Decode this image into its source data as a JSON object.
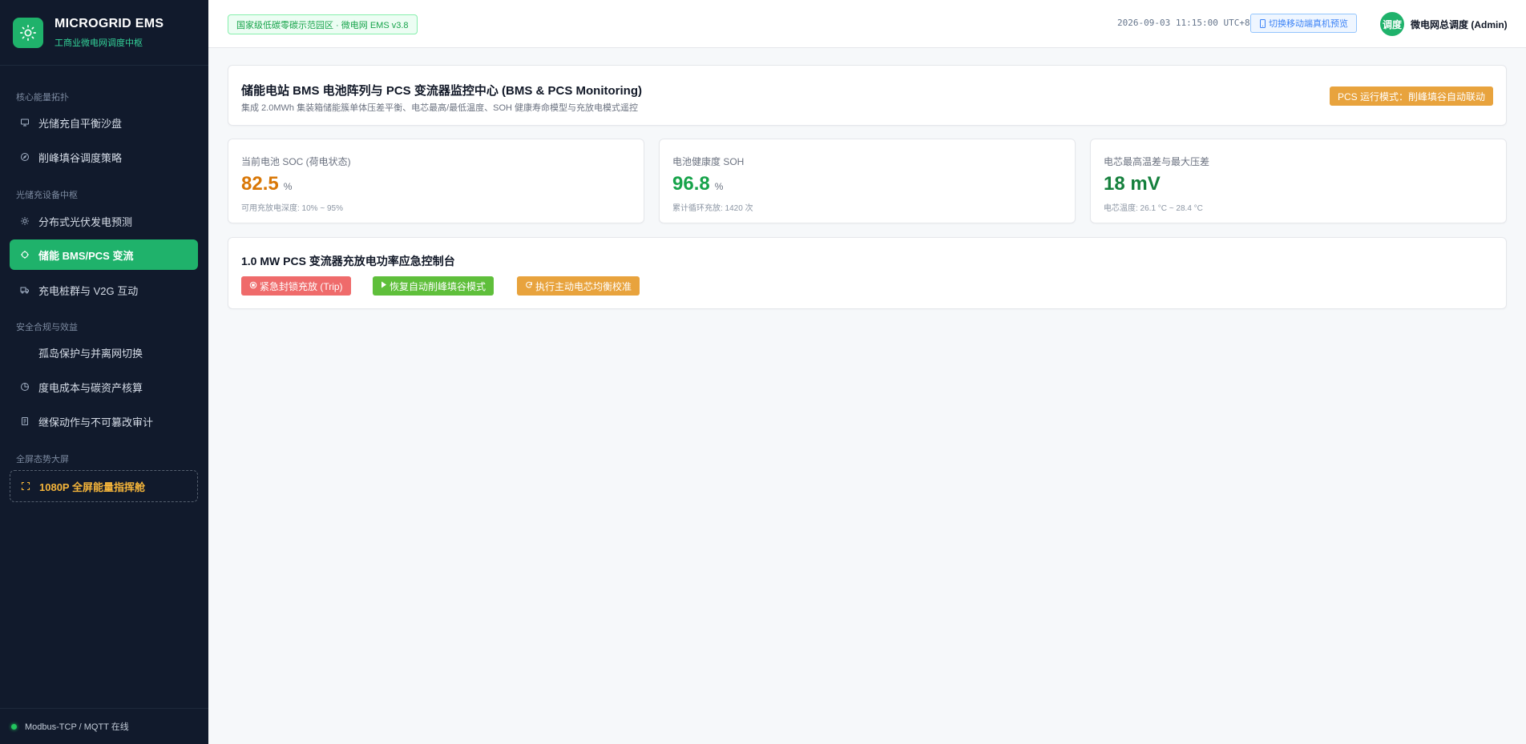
{
  "brand": {
    "title": "MICROGRID EMS",
    "subtitle": "工商业微电网调度中枢",
    "logo_icon": "sun-icon",
    "accent": "#1fb26b"
  },
  "sidebar": {
    "groups": [
      {
        "label": "核心能量拓扑"
      },
      {
        "label": "光储充设备中枢"
      },
      {
        "label": "安全合规与效益"
      },
      {
        "label": "全屏态势大屏"
      }
    ],
    "items": [
      {
        "label": "光储充自平衡沙盘",
        "icon": "monitor-icon",
        "active": false
      },
      {
        "label": "削峰填谷调度策略",
        "icon": "compass-icon",
        "active": false
      },
      {
        "label": "分布式光伏发电预测",
        "icon": "sun-icon",
        "active": false
      },
      {
        "label": "储能 BMS/PCS 变流",
        "icon": "battery-icon",
        "active": true
      },
      {
        "label": "充电桩群与 V2G 互动",
        "icon": "truck-icon",
        "active": false
      },
      {
        "label": "孤岛保护与并离网切换",
        "icon": "",
        "active": false
      },
      {
        "label": "度电成本与碳资产核算",
        "icon": "pie-chart-icon",
        "active": false
      },
      {
        "label": "继保动作与不可篡改审计",
        "icon": "document-icon",
        "active": false
      },
      {
        "label": "1080P 全屏能量指挥舱",
        "icon": "fullscreen-icon",
        "active": false
      }
    ],
    "footer_status": "Modbus-TCP / MQTT 在线"
  },
  "header": {
    "site_badge": "国家级低碳零碳示范园区 · 微电网 EMS v3.8",
    "datetime": "2026-09-03 11:15:00 UTC+8",
    "mobile_preview": "切换移动端真机预览",
    "avatar_text": "调度",
    "username": "微电网总调度 (Admin)"
  },
  "page": {
    "title": "储能电站 BMS 电池阵列与 PCS 变流器监控中心 (BMS & PCS Monitoring)",
    "subtitle": "集成 2.0MWh 集装箱储能簇单体压差平衡、电芯最高/最低温度、SOH 健康寿命模型与充放电模式遥控",
    "mode_badge": "PCS 运行模式：削峰填谷自动联动"
  },
  "kpis": [
    {
      "label": "当前电池 SOC (荷电状态)",
      "value": "82.5",
      "unit": "%",
      "note": "可用充放电深度: 10% ~ 95%",
      "color": "#d97706"
    },
    {
      "label": "电池健康度 SOH",
      "value": "96.8",
      "unit": "%",
      "note": "累计循环充放: 1420 次",
      "color": "#16a34a"
    },
    {
      "label": "电芯最高温差与最大压差",
      "value": "18 mV",
      "unit": "",
      "note": "电芯温度: 26.1 °C ~ 28.4 °C",
      "color": "#15803d"
    }
  ],
  "control": {
    "title": "1.0 MW PCS 变流器充放电功率应急控制台",
    "buttons": [
      {
        "label": "紧急封锁充放 (Trip)",
        "icon": "stop-circle-icon",
        "color": "#ef6b6b"
      },
      {
        "label": "恢复自动削峰填谷模式",
        "icon": "play-icon",
        "color": "#5fbf3b"
      },
      {
        "label": "执行主动电芯均衡校准",
        "icon": "refresh-icon",
        "color": "#e8a33d"
      }
    ]
  }
}
